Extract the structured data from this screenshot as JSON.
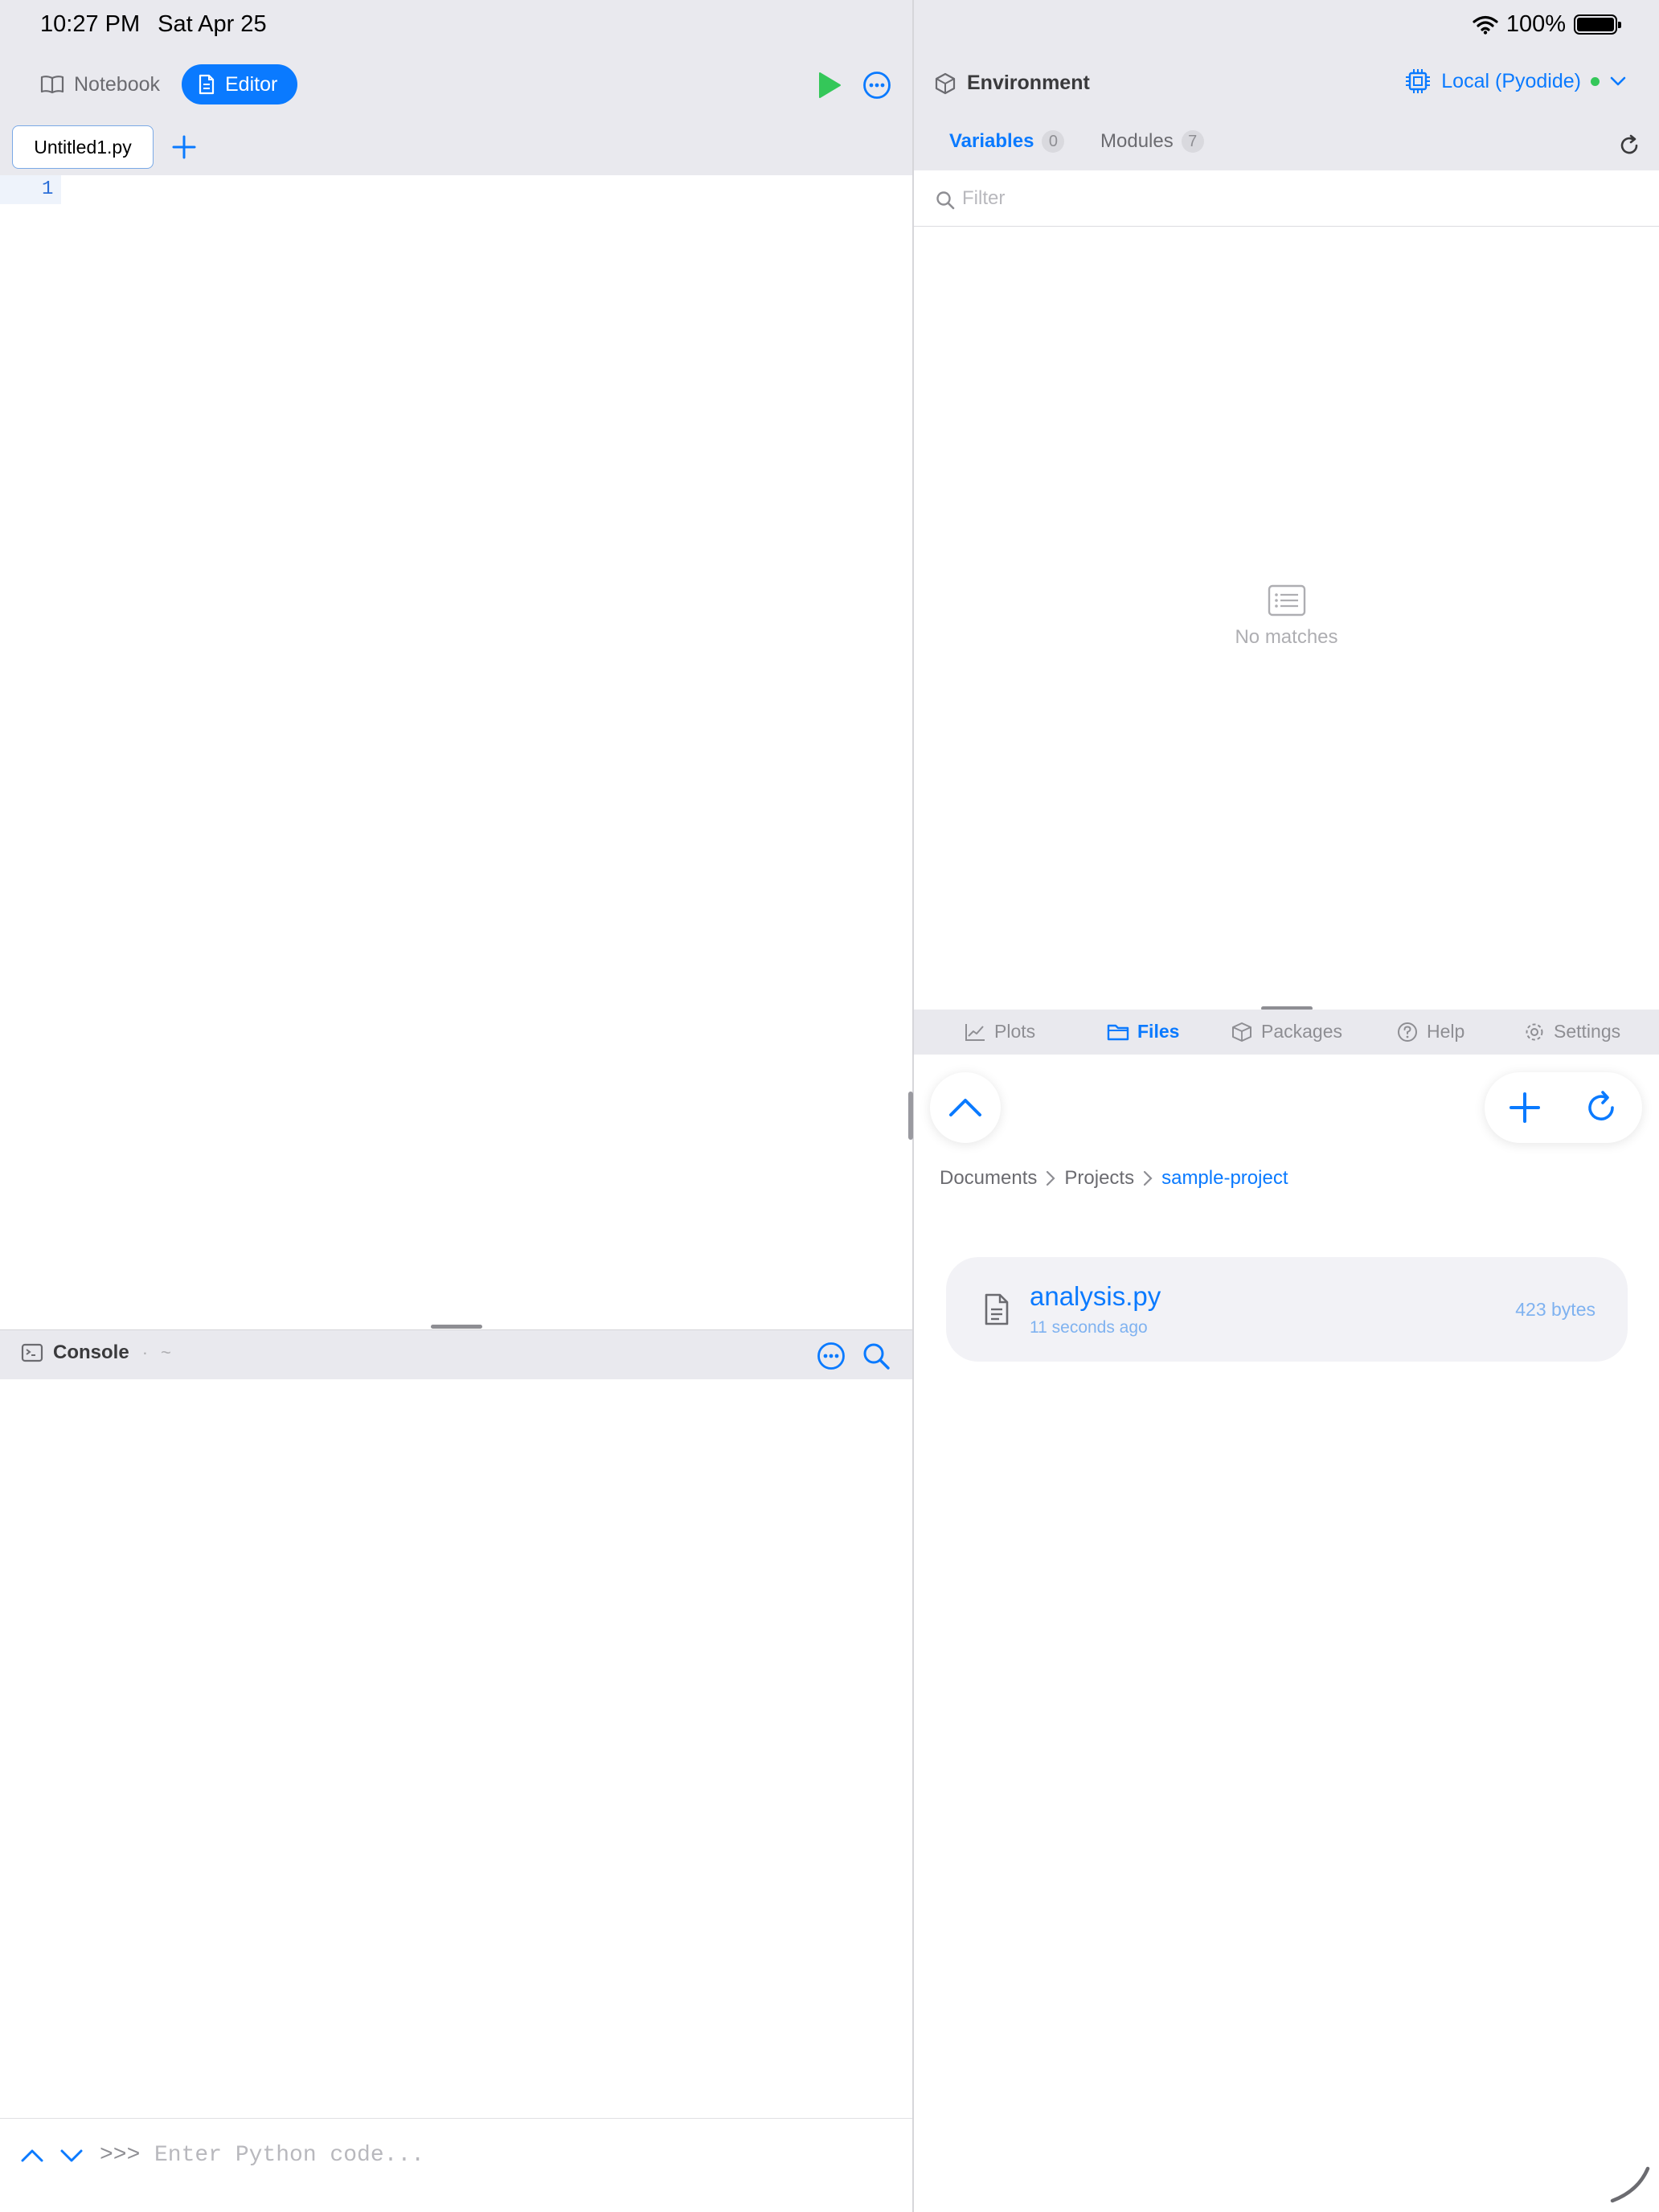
{
  "status_bar": {
    "time": "10:27 PM",
    "date": "Sat Apr 25",
    "battery_text": "100%",
    "battery_level": 1.0
  },
  "left": {
    "modes": {
      "notebook": "Notebook",
      "editor": "Editor"
    },
    "active_mode": "editor",
    "tabs": [
      {
        "label": "Untitled1.py",
        "active": true
      }
    ],
    "editor": {
      "line_numbers": [
        "1"
      ]
    },
    "console": {
      "title": "Console",
      "separator": "·",
      "path": "~",
      "prompt": ">>>",
      "placeholder": "Enter Python code..."
    }
  },
  "right": {
    "environment": {
      "title": "Environment",
      "kernel": "Local (Pyodide)",
      "kernel_status_color": "#34c759",
      "tabs": [
        {
          "label": "Variables",
          "count": "0",
          "active": true
        },
        {
          "label": "Modules",
          "count": "7",
          "active": false
        }
      ],
      "filter_placeholder": "Filter",
      "empty_text": "No matches"
    },
    "panel_tabs": [
      {
        "label": "Plots",
        "icon": "chart-line-icon",
        "active": false
      },
      {
        "label": "Files",
        "icon": "folder-icon",
        "active": true
      },
      {
        "label": "Packages",
        "icon": "box-icon",
        "active": false
      },
      {
        "label": "Help",
        "icon": "question-circle-icon",
        "active": false
      },
      {
        "label": "Settings",
        "icon": "gear-icon",
        "active": false
      }
    ],
    "files": {
      "breadcrumb": [
        "Documents",
        "Projects",
        "sample-project"
      ],
      "items": [
        {
          "name": "analysis.py",
          "modified": "11 seconds ago",
          "size": "423 bytes",
          "icon": "document-icon"
        }
      ]
    }
  },
  "colors": {
    "accent": "#0a7aff",
    "run": "#34c759",
    "chrome": "#e9e9ee"
  }
}
